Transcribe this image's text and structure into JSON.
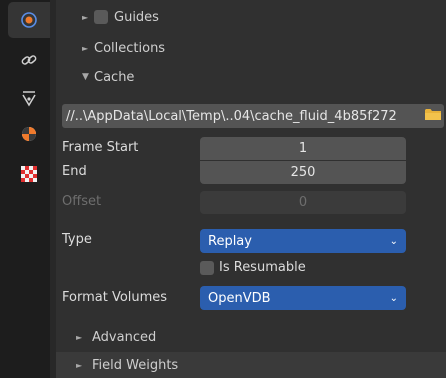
{
  "tabs": [
    {
      "icon": "physics-orbit-icon",
      "active": true
    },
    {
      "icon": "constraint-link-icon",
      "active": false
    },
    {
      "icon": "vertex-funnel-icon",
      "active": false
    },
    {
      "icon": "shading-ball-icon",
      "active": false
    },
    {
      "icon": "texture-checker-icon",
      "active": false
    }
  ],
  "panel": {
    "guides_label": "Guides",
    "collections_label": "Collections",
    "cache_label": "Cache",
    "cache_path": "//..\\AppData\\Local\\Temp\\..04\\cache_fluid_4b85f272",
    "frame_start_label": "Frame Start",
    "frame_start_value": "1",
    "end_label": "End",
    "end_value": "250",
    "offset_label": "Offset",
    "offset_value": "0",
    "type_label": "Type",
    "type_value": "Replay",
    "resumable_label": "Is Resumable",
    "format_volumes_label": "Format Volumes",
    "format_volumes_value": "OpenVDB",
    "advanced_label": "Advanced",
    "field_weights_label": "Field Weights"
  },
  "colors": {
    "accent": "#2b5eae",
    "panel_bg": "#303030",
    "field_bg": "#545454",
    "folder": "#e8b23a"
  }
}
